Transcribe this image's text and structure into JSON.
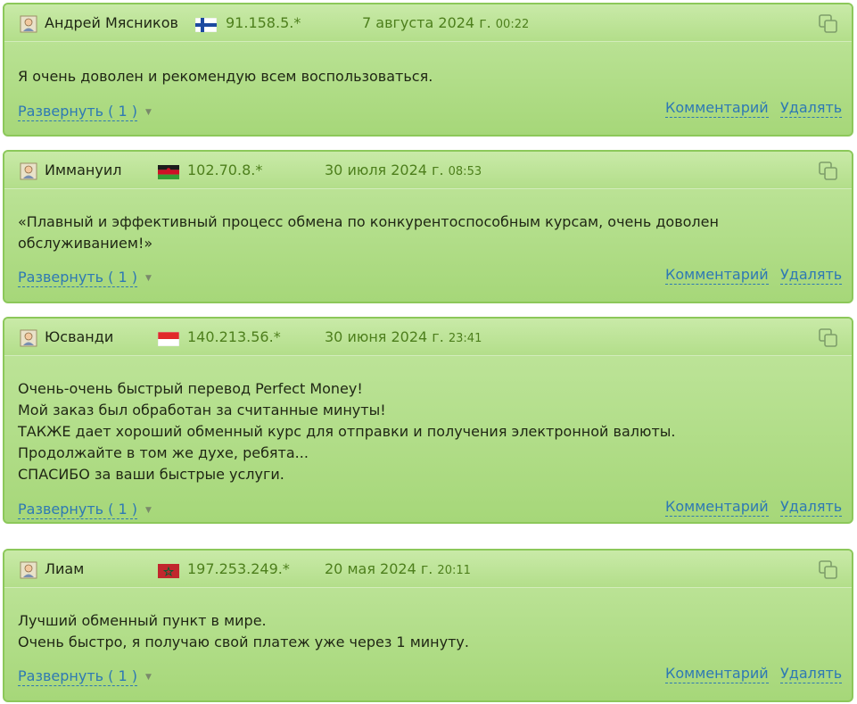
{
  "actions": {
    "expand_label": "Развернуть ( 1 )",
    "comment_label": "Комментарий",
    "delete_label": "Удалять"
  },
  "reviews": [
    {
      "author": "Андрей Мясников",
      "flag": "finland-flag",
      "ip": "91.158.5.*",
      "date": "7 августа 2024 г.",
      "time": "00:22",
      "lines": [
        "Я очень доволен и рекомендую всем воспользоваться."
      ]
    },
    {
      "author": "Иммануил",
      "flag": "malawi-flag",
      "ip": "102.70.8.*",
      "date": "30 июля 2024 г.",
      "time": "08:53",
      "lines": [
        "«Плавный и эффективный процесс обмена по конкурентоспособным курсам, очень доволен",
        "обслуживанием!»"
      ]
    },
    {
      "author": "Юсванди",
      "flag": "indonesia-flag",
      "ip": "140.213.56.*",
      "date": "30 июня 2024 г.",
      "time": "23:41",
      "lines": [
        "Очень-очень быстрый перевод Perfect Money!",
        "Мой заказ был обработан за считанные минуты!",
        "ТАКЖЕ дает хороший обменный курс для отправки и получения электронной валюты.",
        "Продолжайте в том же духе, ребята...",
        "СПАСИБО за ваши быстрые услуги."
      ]
    },
    {
      "author": "Лиам",
      "flag": "morocco-flag",
      "ip": "197.253.249.*",
      "date": "20 мая 2024 г.",
      "time": "20:11",
      "lines": [
        "Лучший обменный пункт в мире.",
        "Очень быстро, я получаю свой платеж уже через 1 минуту."
      ]
    }
  ]
}
